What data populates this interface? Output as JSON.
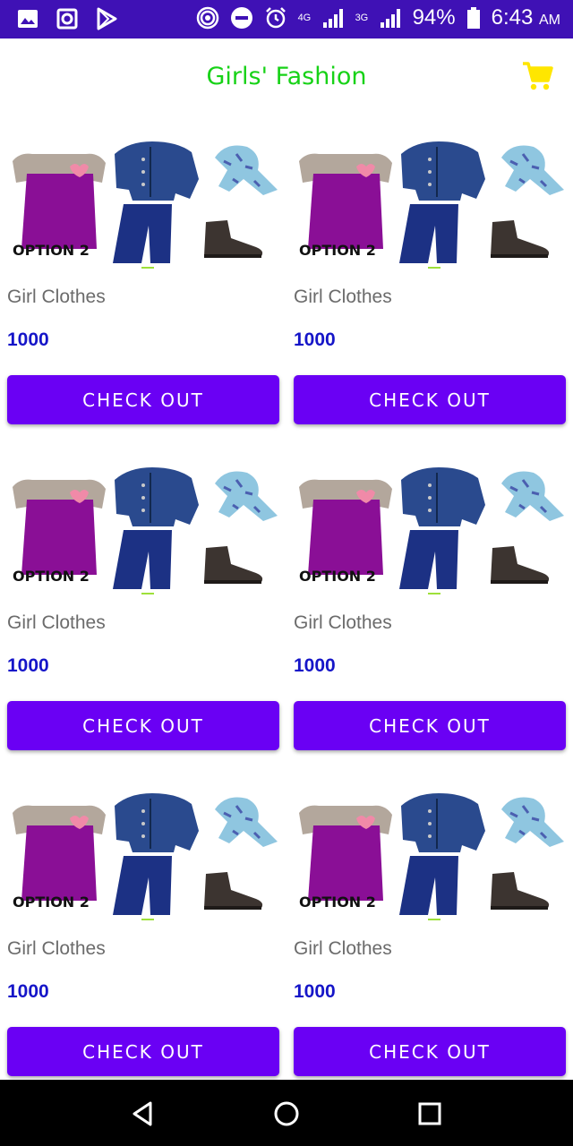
{
  "status_bar": {
    "left_icons": [
      "gallery-icon",
      "screenshot-icon",
      "play-store-icon"
    ],
    "network_4g": "4G",
    "network_3g": "3G",
    "battery": "94%",
    "time": "6:43",
    "ampm": "AM"
  },
  "app_bar": {
    "title": "Girls' Fashion",
    "cart_icon": "cart-icon"
  },
  "colors": {
    "status_bar": "#3f11b5",
    "title": "#17d217",
    "cart": "#ffe600",
    "button": "#6a00f4",
    "price": "#1515c8"
  },
  "products": [
    {
      "image_label": "OPTION 2",
      "name": "Girl Clothes",
      "price": "1000",
      "button": "CHECK OUT"
    },
    {
      "image_label": "OPTION 2",
      "name": "Girl Clothes",
      "price": "1000",
      "button": "CHECK OUT"
    },
    {
      "image_label": "OPTION 2",
      "name": "Girl Clothes",
      "price": "1000",
      "button": "CHECK OUT"
    },
    {
      "image_label": "OPTION 2",
      "name": "Girl Clothes",
      "price": "1000",
      "button": "CHECK OUT"
    },
    {
      "image_label": "OPTION 2",
      "name": "Girl Clothes",
      "price": "1000",
      "button": "CHECK OUT"
    },
    {
      "image_label": "OPTION 2",
      "name": "Girl Clothes",
      "price": "1000",
      "button": "CHECK OUT"
    }
  ],
  "nav_bar": [
    "back-icon",
    "home-icon",
    "recents-icon"
  ]
}
